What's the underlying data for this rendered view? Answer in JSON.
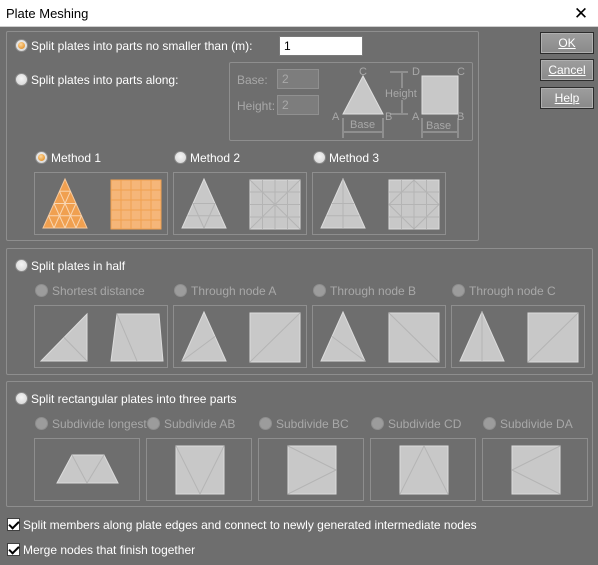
{
  "window": {
    "title": "Plate Meshing"
  },
  "buttons": {
    "ok": "OK",
    "cancel": "Cancel",
    "help": "Help"
  },
  "split_min": {
    "label": "Split plates into parts no smaller than (m):",
    "value": "1"
  },
  "split_along": {
    "label": "Split plates into parts along:",
    "base_label": "Base:",
    "base_value": "2",
    "height_label": "Height:",
    "height_value": "2",
    "diagram": {
      "a": "A",
      "b": "B",
      "c": "C",
      "d": "D",
      "base": "Base",
      "height": "Height"
    }
  },
  "methods": [
    "Method 1",
    "Method 2",
    "Method 3"
  ],
  "half": {
    "label": "Split plates in half",
    "options": [
      "Shortest distance",
      "Through node A",
      "Through node B",
      "Through node C"
    ]
  },
  "three": {
    "label": "Split rectangular plates into three parts",
    "options": [
      "Subdivide longest",
      "Subdivide AB",
      "Subdivide BC",
      "Subdivide CD",
      "Subdivide DA"
    ]
  },
  "split_members": {
    "label": "Split members along plate edges and connect to newly generated intermediate nodes"
  },
  "merge_nodes": {
    "label": "Merge nodes that finish together"
  },
  "colors": {
    "accent": "#f0a050",
    "disabled_shape": "#c8c8c8"
  }
}
